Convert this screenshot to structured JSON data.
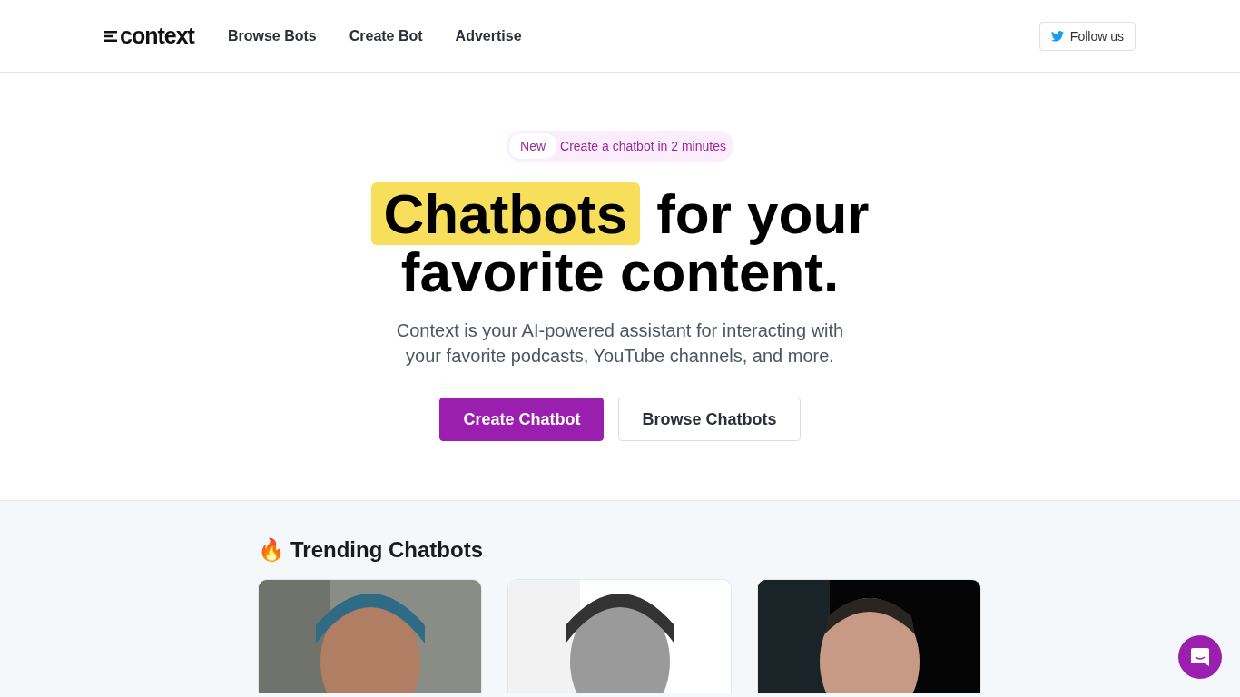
{
  "header": {
    "logo": "context",
    "nav": [
      {
        "label": "Browse Bots"
      },
      {
        "label": "Create Bot"
      },
      {
        "label": "Advertise"
      }
    ],
    "follow_button": "Follow us"
  },
  "hero": {
    "badge": {
      "tag": "New",
      "text": "Create a chatbot in 2 minutes"
    },
    "headline": {
      "highlight": "Chatbots",
      "rest": "for your favorite content."
    },
    "subtitle": "Context is your AI-powered assistant for interacting with your favorite podcasts, YouTube channels, and more.",
    "buttons": [
      {
        "label": "Create Chatbot",
        "kind": "primary"
      },
      {
        "label": "Browse Chatbots",
        "kind": "secondary"
      }
    ]
  },
  "trending": {
    "icon": "🔥",
    "title": "Trending Chatbots"
  }
}
